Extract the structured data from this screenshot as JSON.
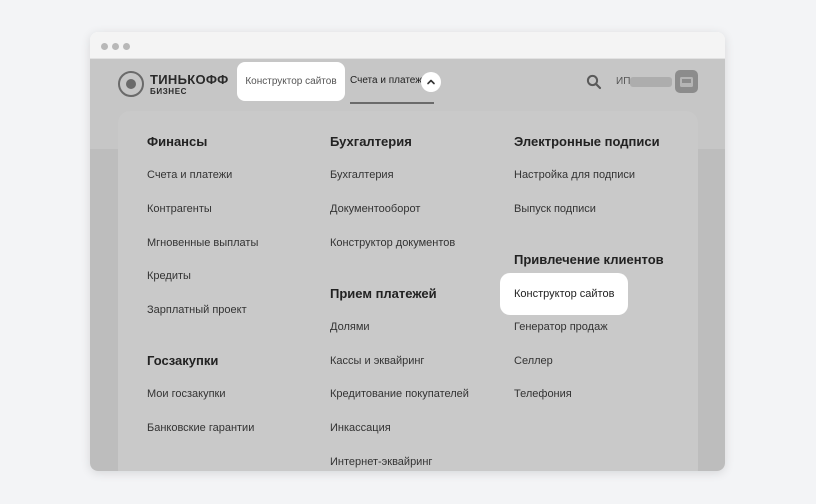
{
  "header": {
    "logo_main": "ТИНЬКОФФ",
    "logo_sub": "БИЗНЕС",
    "nav_site_builder": "Конструктор сайтов",
    "nav_accounts": "Счета и платежи",
    "user_prefix": "ИП"
  },
  "menu": {
    "col1": {
      "heading1": "Финансы",
      "items1": [
        "Счета и платежи",
        "Контрагенты",
        "Мгновенные выплаты",
        "Кредиты",
        "Зарплатный проект"
      ],
      "heading2": "Госзакупки",
      "items2": [
        "Мои госзакупки",
        "Банковские гарантии"
      ]
    },
    "col2": {
      "heading1": "Бухгалтерия",
      "items1": [
        "Бухгалтерия",
        "Документооборот",
        "Конструктор документов"
      ],
      "heading2": "Прием платежей",
      "items2": [
        "Долями",
        "Кассы и эквайринг",
        "Кредитование покупателей",
        "Инкассация",
        "Интернет-эквайринг"
      ]
    },
    "col3": {
      "heading1": "Электронные подписи",
      "items1": [
        "Настройка для подписи",
        "Выпуск подписи"
      ],
      "heading2": "Привлечение клиентов",
      "items2": [
        "Конструктор сайтов",
        "Генератор продаж",
        "Селлер",
        "Телефония"
      ]
    }
  },
  "colors": {
    "page_bg": "#f3f4f6",
    "overlay": "#bdbdbd",
    "panel": "#c9c9c9",
    "highlight": "#ffffff"
  },
  "icons": [
    "search-icon",
    "chevron-up-icon",
    "logo-emblem-icon",
    "avatar-icon"
  ]
}
